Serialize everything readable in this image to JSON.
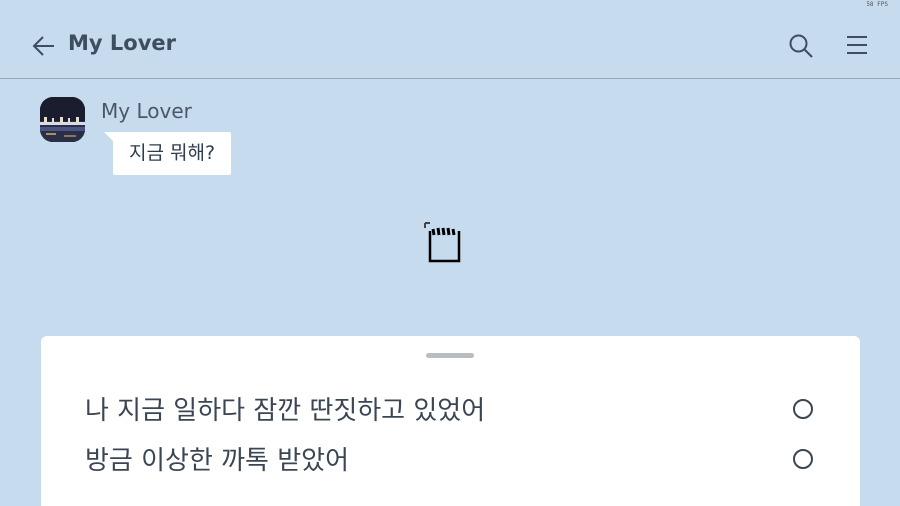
{
  "system": {
    "fps": "58 FPS"
  },
  "header": {
    "title": "My Lover",
    "back_icon": "arrow-left-icon",
    "search_icon": "search-icon",
    "menu_icon": "hamburger-menu-icon"
  },
  "chat": {
    "sender": "My Lover",
    "message": "지금 뭐해?"
  },
  "reply_sheet": {
    "options": [
      {
        "label": "나 지금 일하다 잠깐 딴짓하고 있었어"
      },
      {
        "label": "방금 이상한 까톡 받았어"
      }
    ]
  },
  "colors": {
    "background": "#c6dbee",
    "bubble": "#ffffff",
    "text": "#3e4d5f"
  }
}
